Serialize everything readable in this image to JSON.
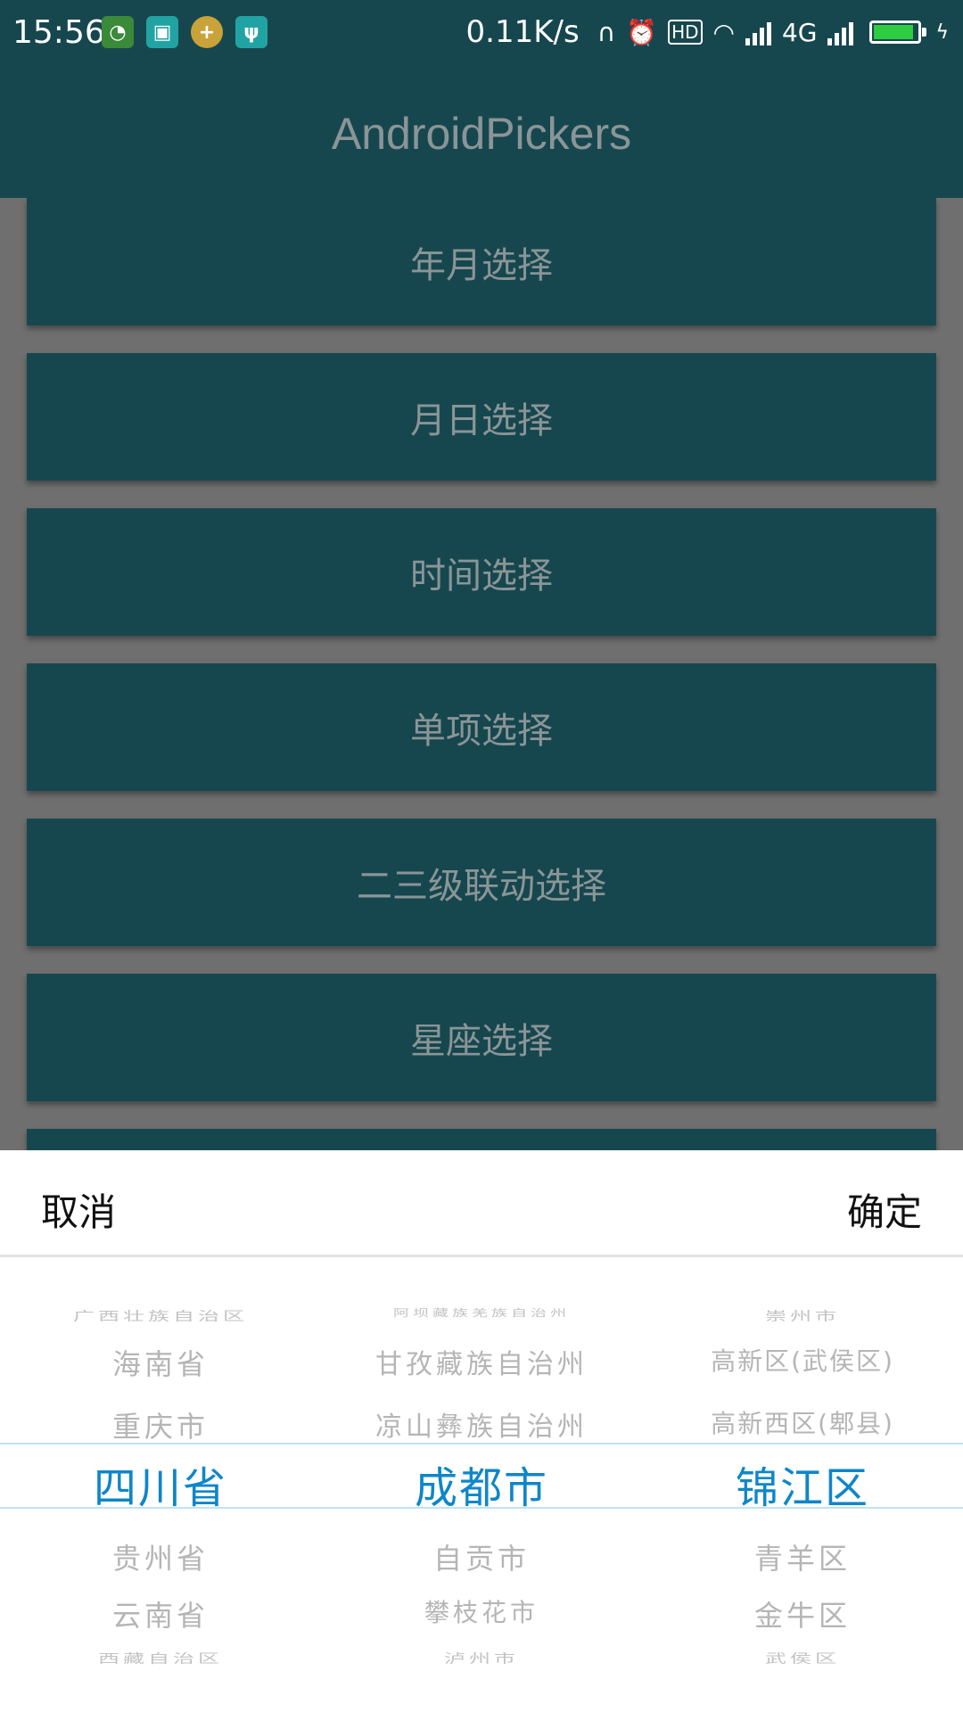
{
  "status_bar": {
    "time": "15:56",
    "left_icons": [
      "wechat-icon",
      "scan-icon",
      "add-circle-icon",
      "usb-icon"
    ],
    "net_speed": "0.11K/s",
    "hd_label": "HD",
    "network_type": "4G",
    "right_icons": [
      "headphones-icon",
      "alarm-icon",
      "hd-icon",
      "wifi-icon",
      "signal-icon",
      "signal-icon",
      "battery-icon"
    ]
  },
  "toolbar": {
    "title": "AndroidPickers"
  },
  "menu": {
    "buttons": [
      "年月选择",
      "月日选择",
      "时间选择",
      "单项选择",
      "二三级联动选择",
      "星座选择"
    ]
  },
  "picker": {
    "cancel": "取消",
    "confirm": "确定",
    "province": {
      "above": [
        "广西壮族自治区",
        "海南省",
        "重庆市"
      ],
      "selected": "四川省",
      "below": [
        "贵州省",
        "云南省",
        "西藏自治区"
      ]
    },
    "city": {
      "above": [
        "阿坝藏族羌族自治州",
        "甘孜藏族自治州",
        "凉山彝族自治州"
      ],
      "selected": "成都市",
      "below": [
        "自贡市",
        "攀枝花市",
        "泸州市"
      ]
    },
    "district": {
      "above": [
        "崇州市",
        "高新区(武侯区)",
        "高新西区(郫县)"
      ],
      "selected": "锦江区",
      "below": [
        "青羊区",
        "金牛区",
        "武侯区"
      ]
    }
  },
  "colors": {
    "primary": "#17474e",
    "dim_overlay": "#6f6f6f",
    "selected_text": "#0f86c8",
    "unselected_text": "#b5b5b5"
  }
}
